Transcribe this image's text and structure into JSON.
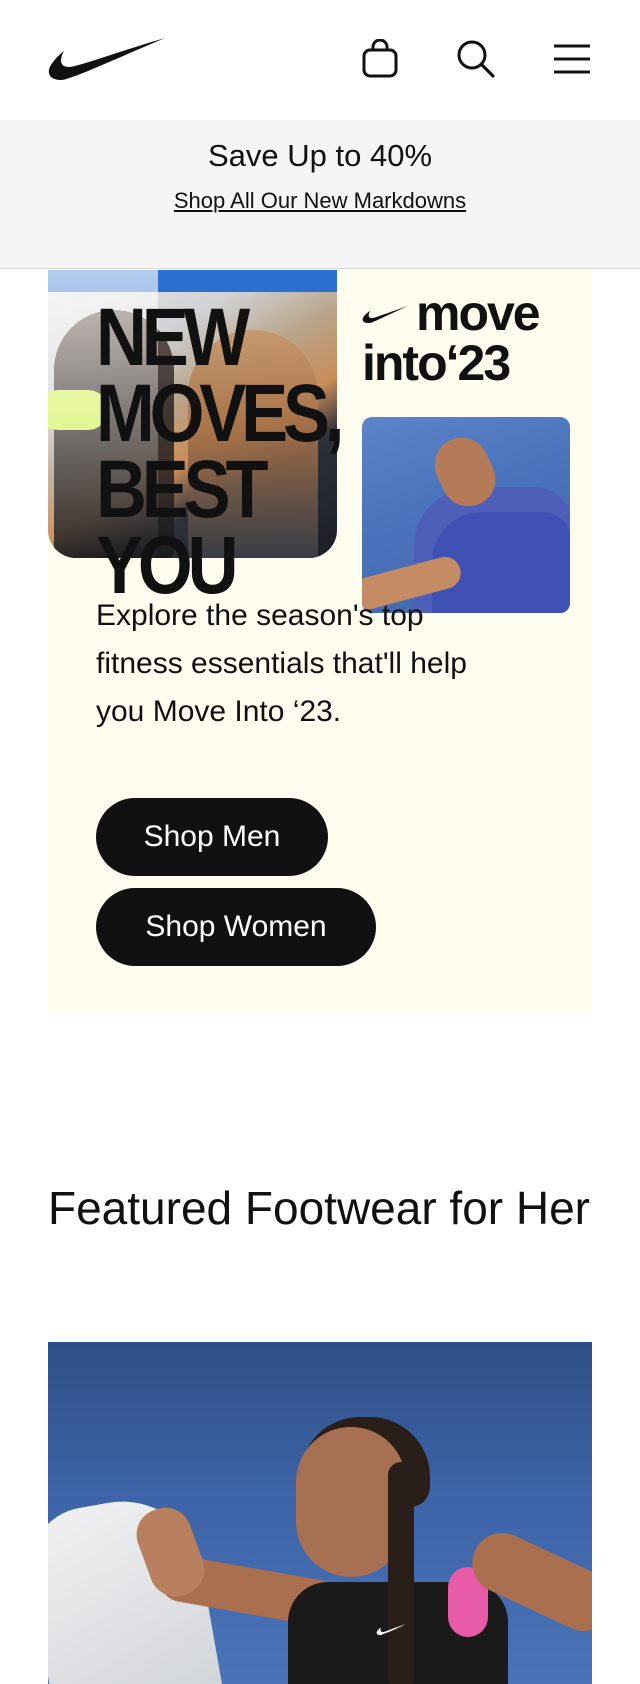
{
  "header": {
    "logo_icon": "nike-swoosh-icon",
    "bag_icon": "shopping-bag-icon",
    "search_icon": "search-icon",
    "menu_icon": "hamburger-menu-icon"
  },
  "promo": {
    "title": "Save Up to 40%",
    "link": "Shop All Our New Markdowns"
  },
  "hero": {
    "brand_line1": "move",
    "brand_line2": "into‘23",
    "headline": [
      "NEW",
      "MOVES,",
      "BEST YOU"
    ],
    "description": "Explore the season's top fitness essentials that'll help you Move Into ‘23.",
    "buttons": {
      "men": "Shop Men",
      "women": "Shop Women"
    },
    "background_color": "#fffcf0"
  },
  "featured": {
    "title": "Featured Footwear for Her"
  },
  "colors": {
    "primary": "#111111",
    "promo_bg": "#f5f5f5",
    "hero_bg": "#fffcf0"
  }
}
